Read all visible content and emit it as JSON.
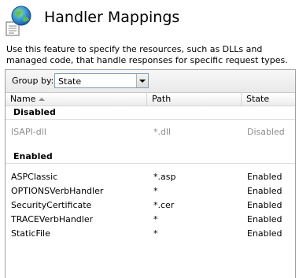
{
  "header": {
    "title": "Handler Mappings",
    "icon": "globe-document-icon"
  },
  "description": "Use this feature to specify the resources, such as DLLs and managed code, that handle responses for specific request types.",
  "group_by": {
    "label": "Group by:",
    "value": "State"
  },
  "columns": {
    "name": "Name",
    "path": "Path",
    "state": "State"
  },
  "groups": [
    {
      "title": "Disabled",
      "rows": [
        {
          "name": "ISAPI-dll",
          "path": "*.dll",
          "state": "Disabled"
        }
      ]
    },
    {
      "title": "Enabled",
      "rows": [
        {
          "name": "ASPClassic",
          "path": "*.asp",
          "state": "Enabled"
        },
        {
          "name": "OPTIONSVerbHandler",
          "path": "*",
          "state": "Enabled"
        },
        {
          "name": "SecurityCertificate",
          "path": "*.cer",
          "state": "Enabled"
        },
        {
          "name": "TRACEVerbHandler",
          "path": "*",
          "state": "Enabled"
        },
        {
          "name": "StaticFile",
          "path": "*",
          "state": "Enabled"
        }
      ]
    }
  ],
  "colors": {
    "disabled_text": "#8c8c8c",
    "border": "#a0a0a0"
  }
}
